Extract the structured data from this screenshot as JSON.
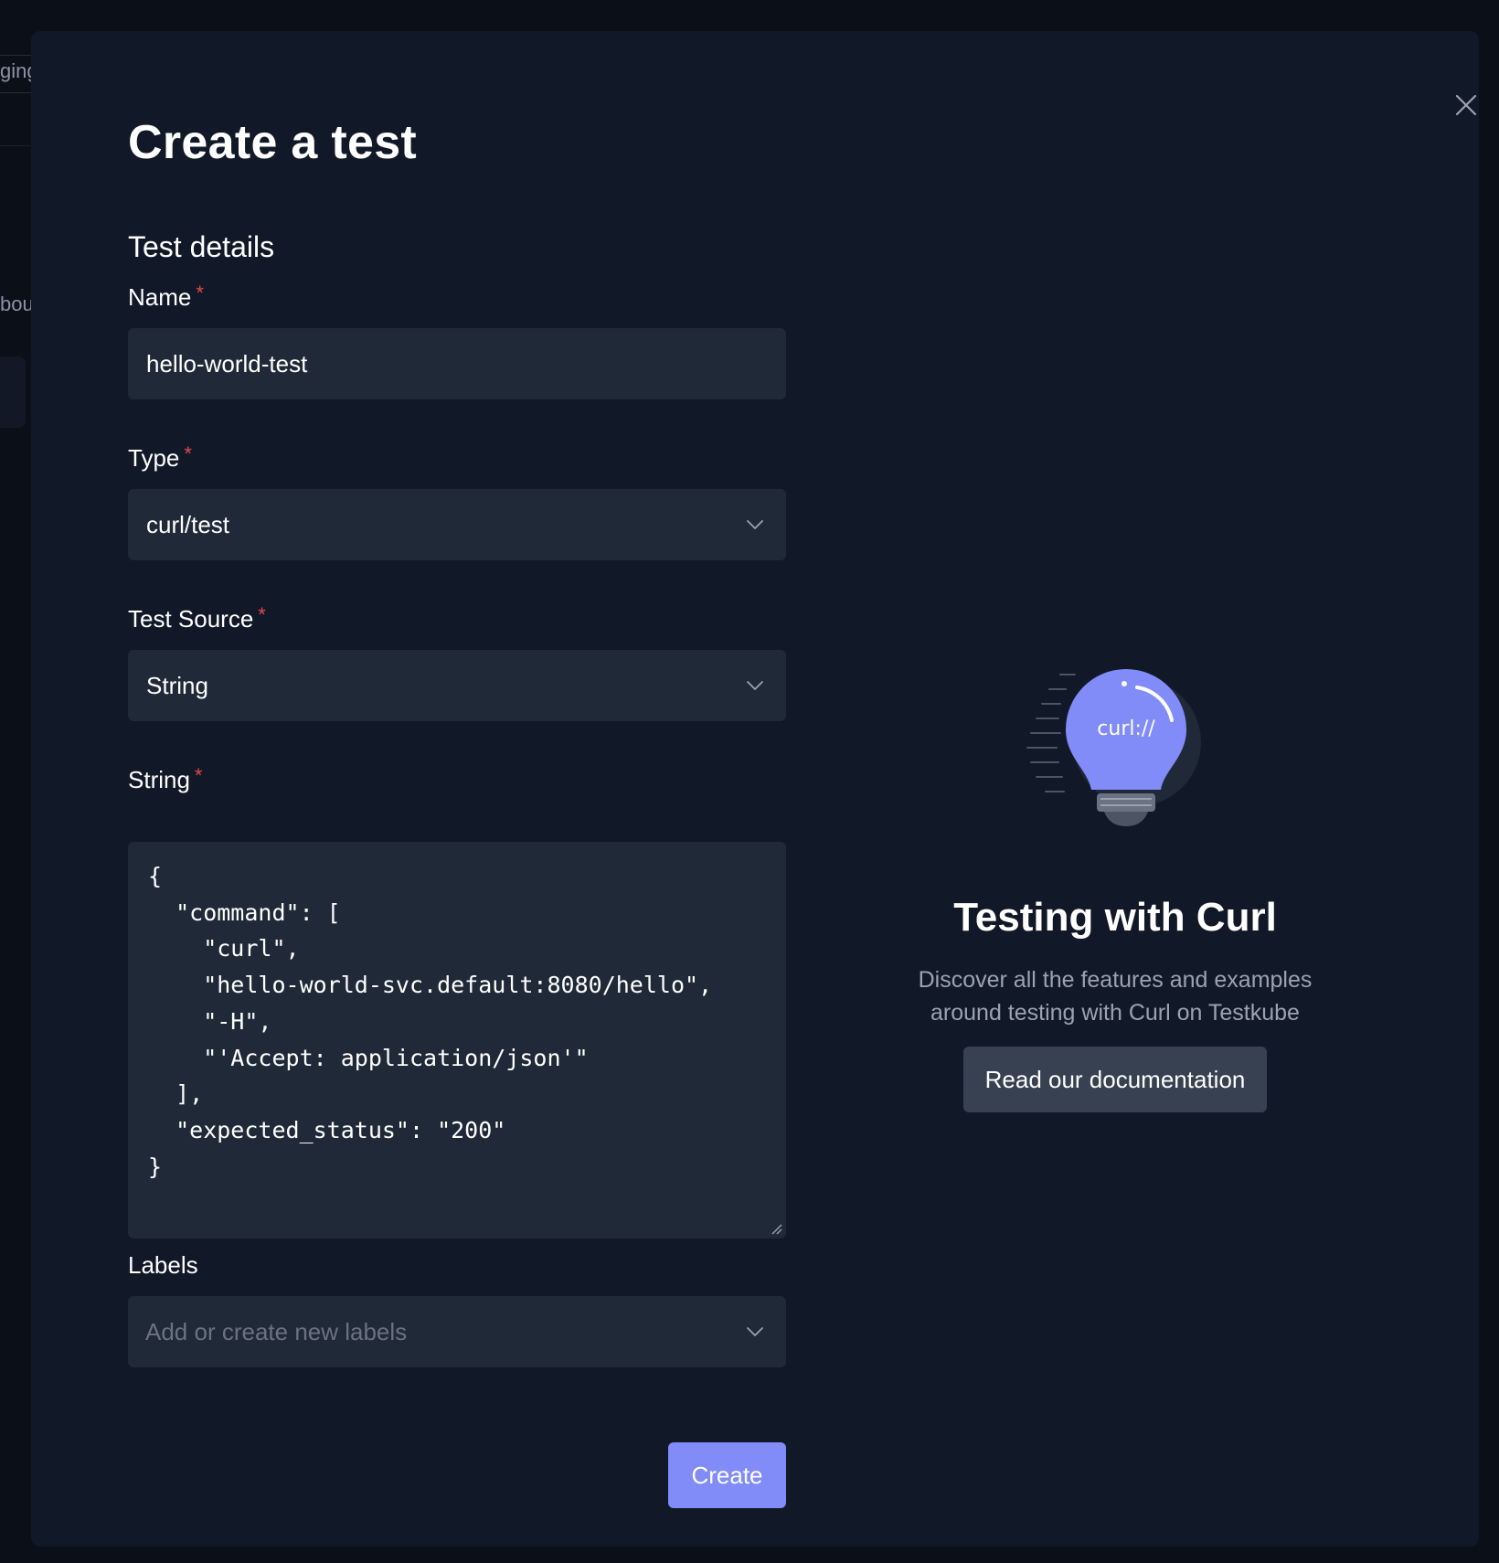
{
  "background": {
    "fragment_1": "ging",
    "fragment_2": "bou"
  },
  "modal": {
    "title": "Create a test",
    "close_icon": "close-icon",
    "section_title": "Test details"
  },
  "form": {
    "name": {
      "label": "Name",
      "required_mark": "*",
      "value": "hello-world-test"
    },
    "type": {
      "label": "Type",
      "required_mark": "*",
      "value": "curl/test",
      "icon": "chevron-down-icon"
    },
    "source": {
      "label": "Test Source",
      "required_mark": "*",
      "value": "String",
      "icon": "chevron-down-icon"
    },
    "string": {
      "label": "String",
      "required_mark": "*",
      "value": "{\n  \"command\": [\n    \"curl\",\n    \"hello-world-svc.default:8080/hello\",\n    \"-H\",\n    \"'Accept: application/json'\"\n  ],\n  \"expected_status\": \"200\"\n}"
    },
    "labels": {
      "label": "Labels",
      "placeholder": "Add or create new labels",
      "icon": "chevron-down-icon"
    },
    "submit_label": "Create"
  },
  "promo": {
    "illustration": "lightbulb-illustration",
    "illustration_text": "curl://",
    "title": "Testing with Curl",
    "description_line1": "Discover all the features and examples",
    "description_line2": "around testing with Curl on Testkube",
    "button_label": "Read our documentation"
  },
  "colors": {
    "page_bg": "#0b0f18",
    "modal_bg": "#111827",
    "field_bg": "#1f2937",
    "accent": "#818cf8",
    "required": "#e5484d",
    "muted_text": "#9ca3af",
    "secondary_button": "#374151"
  }
}
